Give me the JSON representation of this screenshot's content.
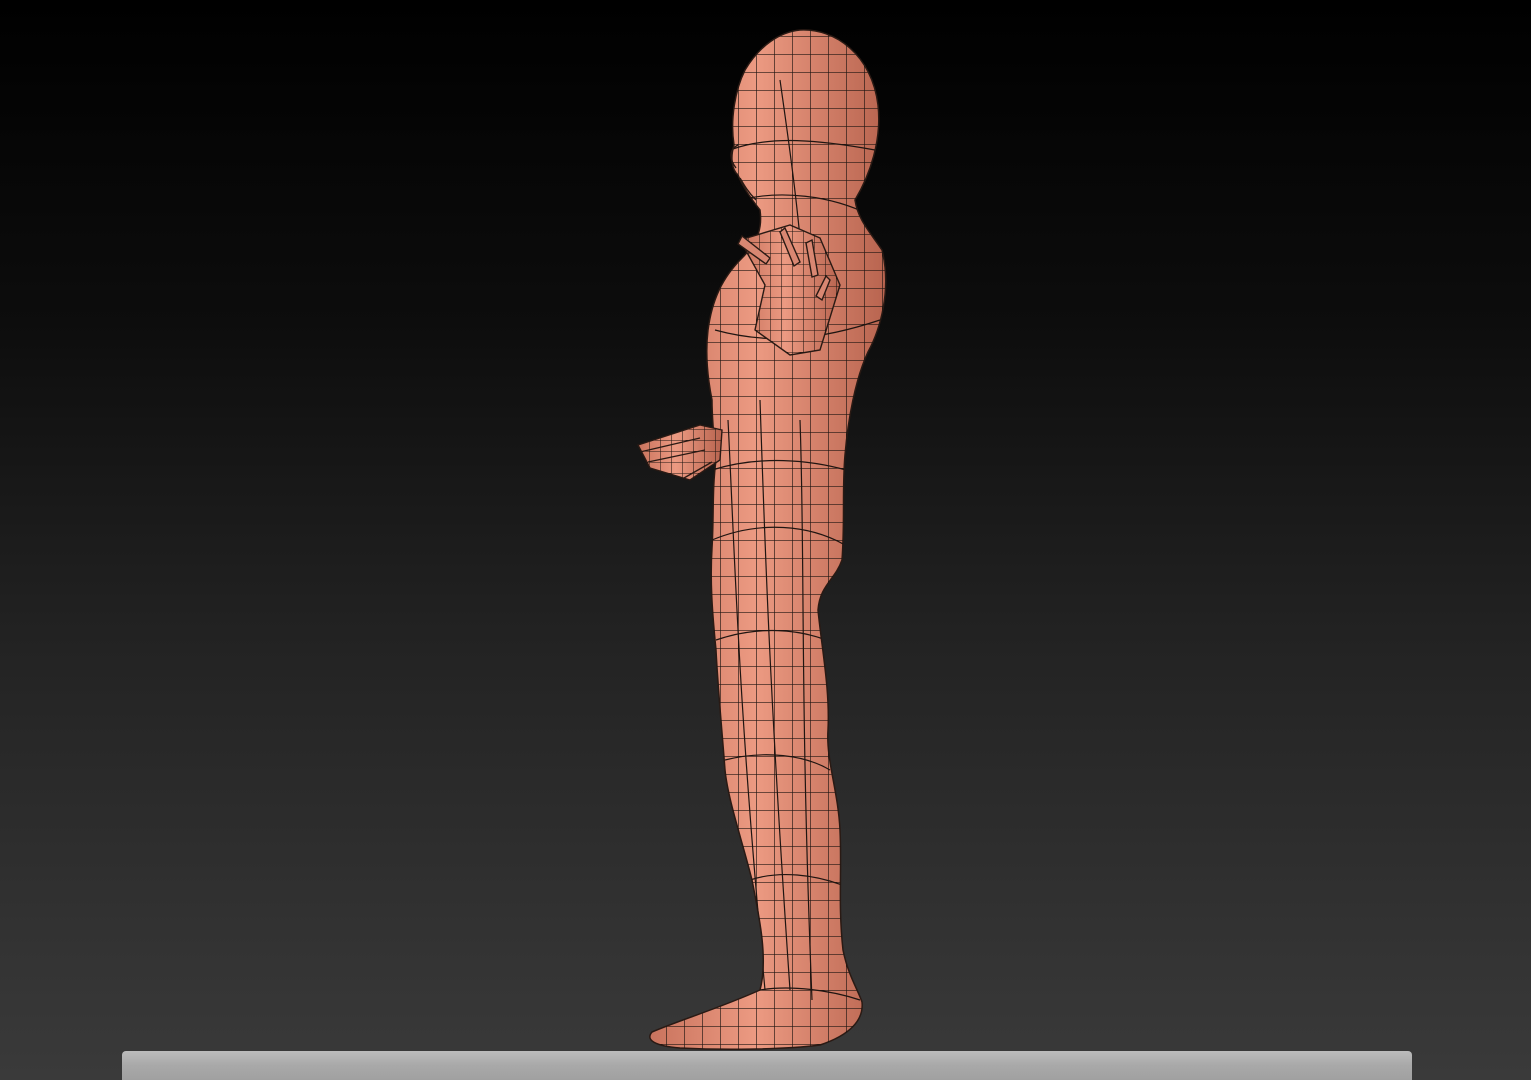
{
  "viewport": {
    "background_top": "#000000",
    "background_bottom": "#3a3a3a"
  },
  "model": {
    "view": "side",
    "display": "polygroup-wireframe",
    "skin_color": "#e1907a",
    "wire_color": "#1c1410"
  },
  "floor": {
    "color": "#b0b0b0"
  }
}
